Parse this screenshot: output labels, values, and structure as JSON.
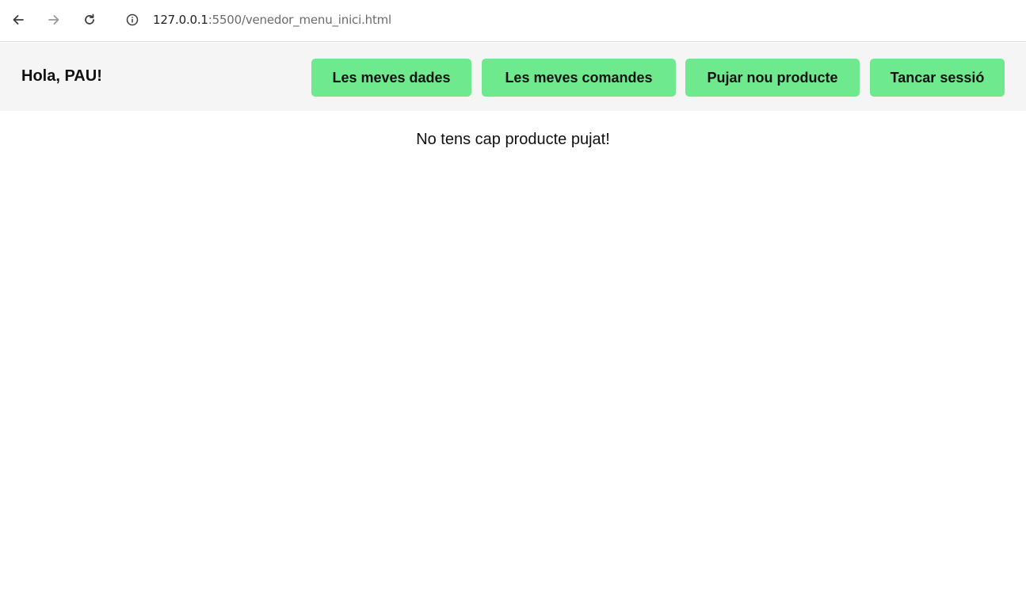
{
  "browser": {
    "url_host": "127.0.0.1",
    "url_rest": ":5500/venedor_menu_inici.html",
    "icons": {
      "back": "arrow-left-icon",
      "forward": "arrow-right-icon",
      "reload": "reload-icon",
      "site_info": "info-icon"
    }
  },
  "header": {
    "greeting": "Hola, PAU!",
    "buttons": {
      "my_data": "Les meves dades",
      "my_orders": "Les meves comandes",
      "upload_product": "Pujar nou producte",
      "logout": "Tancar sessió"
    },
    "button_color": "#6ee98d",
    "background_color": "#f5f5f5"
  },
  "main": {
    "empty_message": "No tens cap producte pujat!"
  }
}
